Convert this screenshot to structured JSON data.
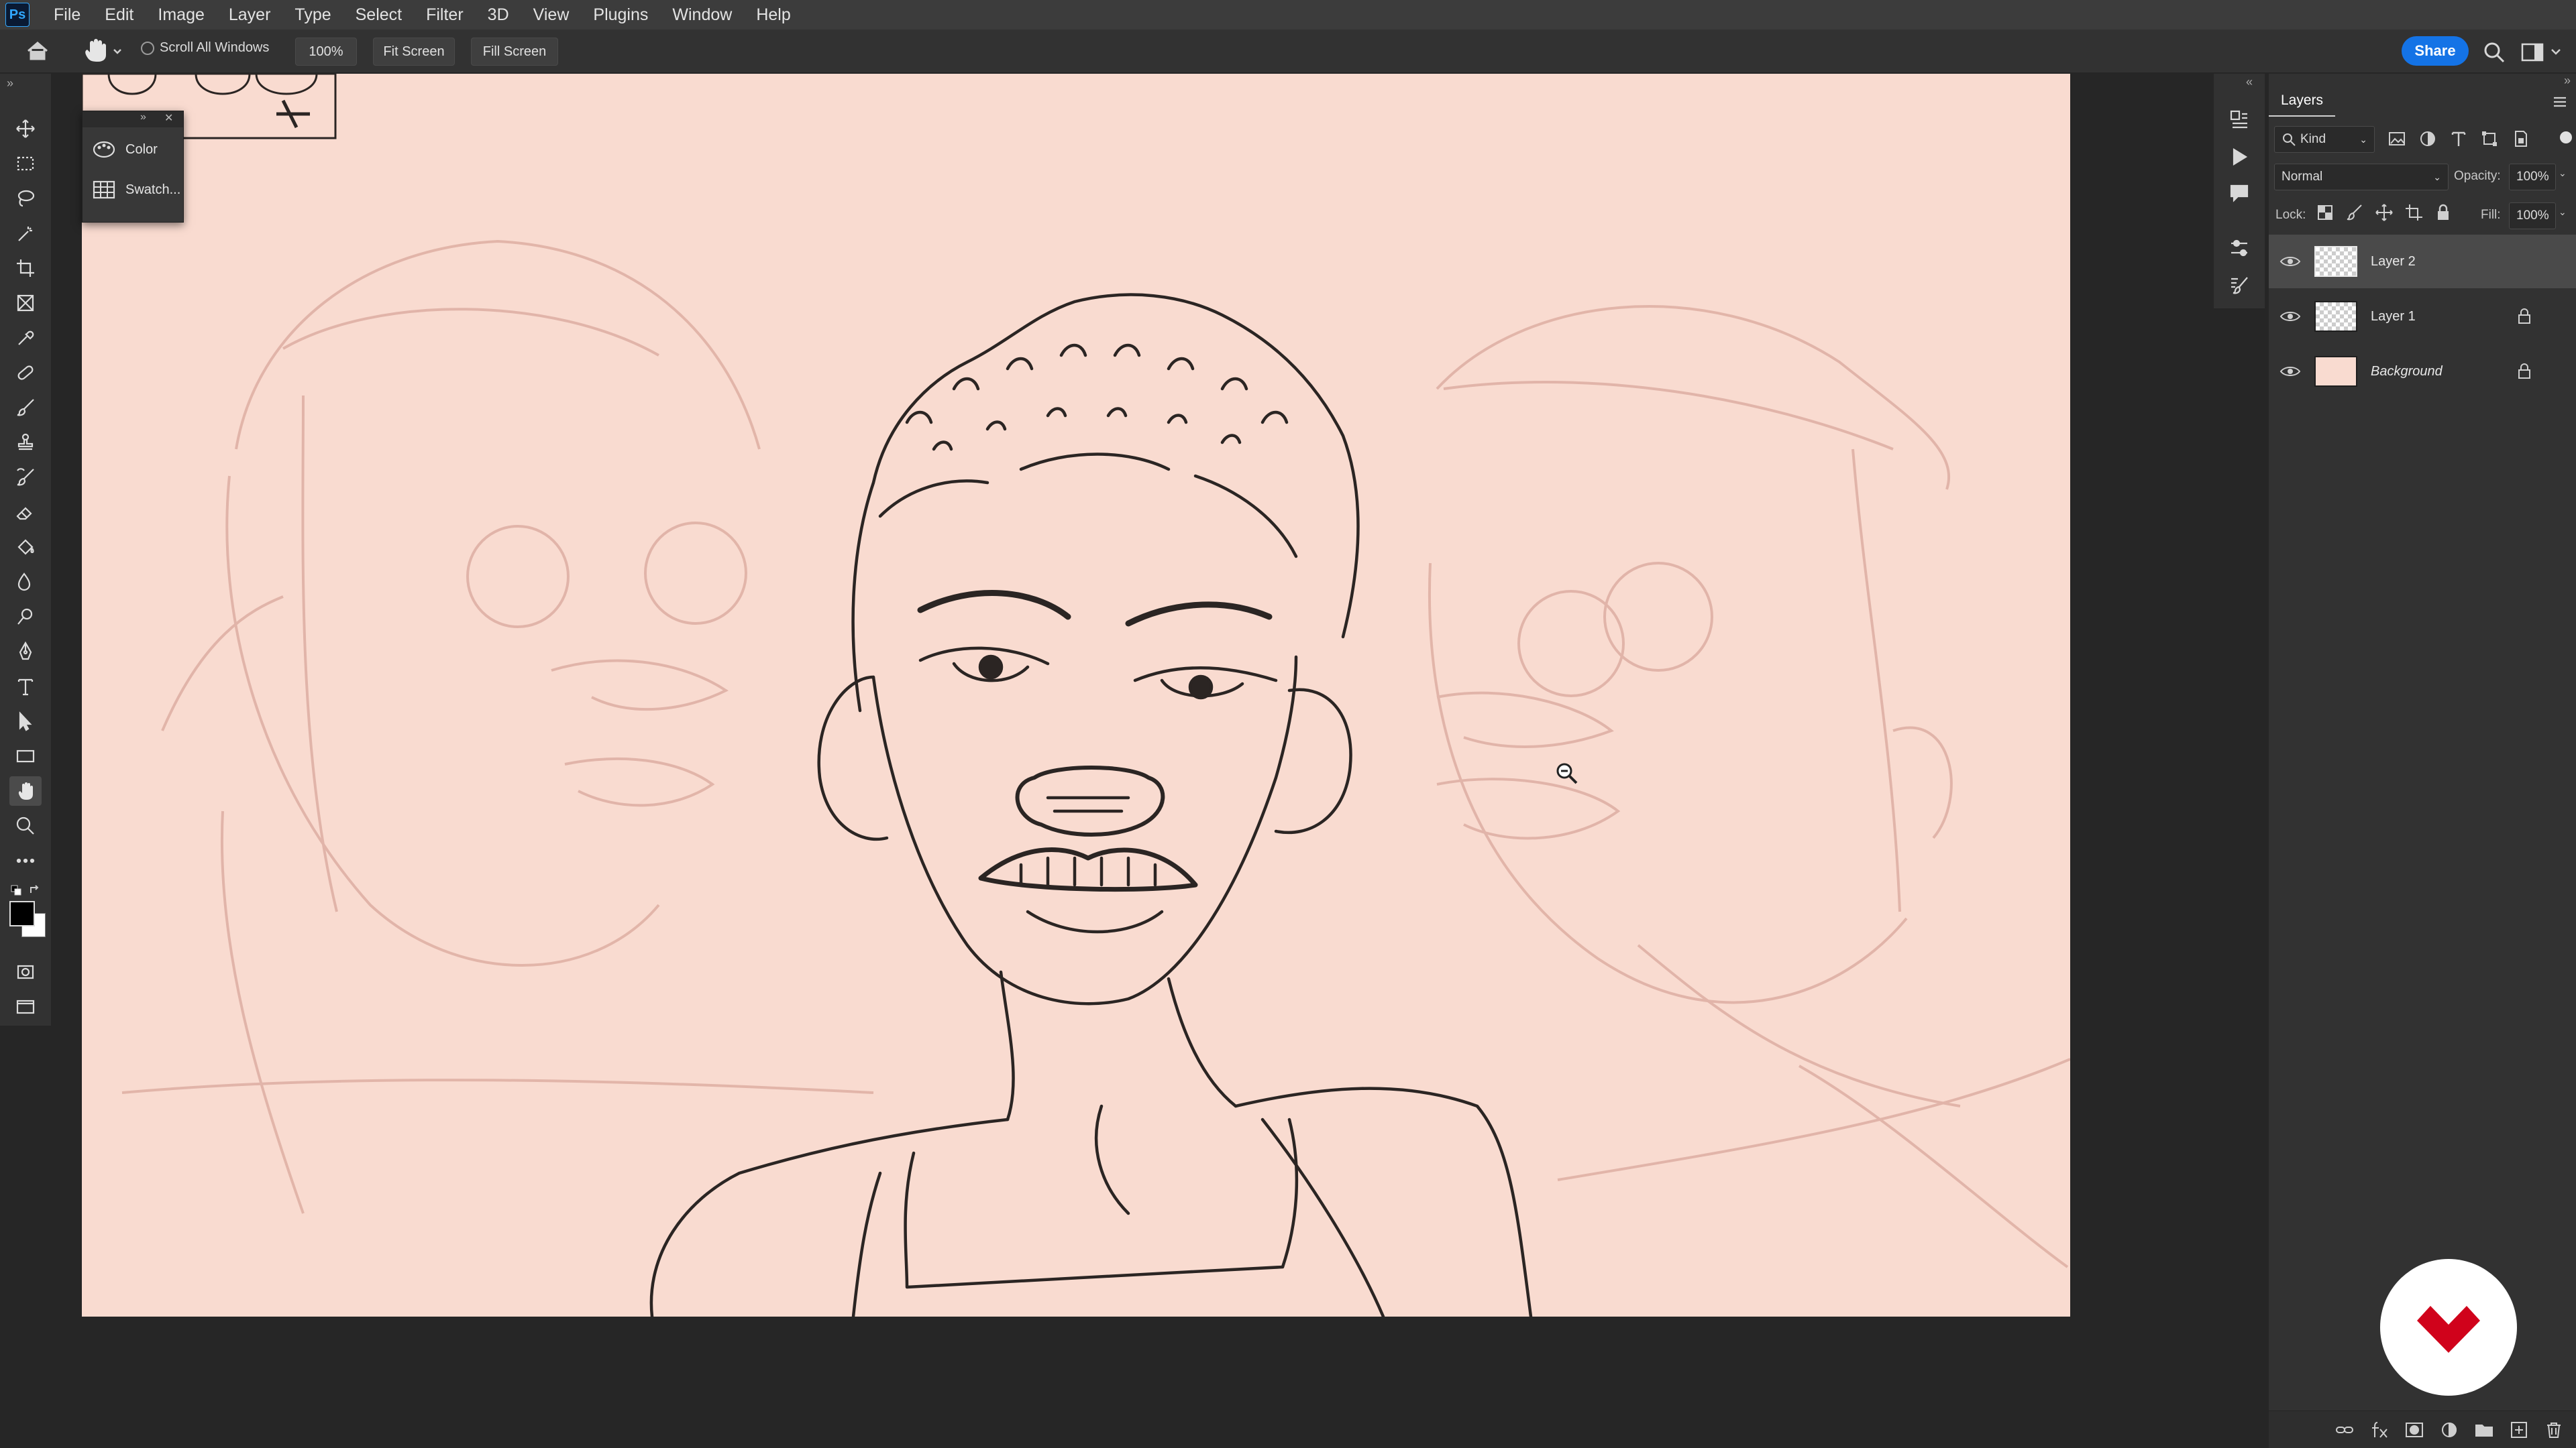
{
  "app": {
    "logo": "Ps"
  },
  "menu": [
    "File",
    "Edit",
    "Image",
    "Layer",
    "Type",
    "Select",
    "Filter",
    "3D",
    "View",
    "Plugins",
    "Window",
    "Help"
  ],
  "options_bar": {
    "scroll_all_windows": "Scroll All Windows",
    "zoom_value": "100%",
    "fit_screen": "Fit Screen",
    "fill_screen": "Fill Screen",
    "share": "Share"
  },
  "floating_panel": {
    "items": [
      {
        "label": "Color",
        "icon": "color-palette-icon"
      },
      {
        "label": "Swatch...",
        "icon": "swatches-grid-icon"
      }
    ]
  },
  "layers_panel": {
    "tab": "Layers",
    "filter_kind": "Kind",
    "blend_mode": "Normal",
    "opacity_label": "Opacity:",
    "opacity_value": "100%",
    "lock_label": "Lock:",
    "fill_label": "Fill:",
    "fill_value": "100%",
    "layers": [
      {
        "name": "Layer 2",
        "selected": true,
        "locked": false,
        "thumb": "transparent"
      },
      {
        "name": "Layer 1",
        "selected": false,
        "locked": true,
        "thumb": "transparent"
      },
      {
        "name": "Background",
        "selected": false,
        "locked": true,
        "thumb": "#f9dbd0"
      }
    ]
  },
  "colors": {
    "canvas": "#f9dbd0",
    "accent": "#1473e6",
    "badge": "#d0021b"
  }
}
